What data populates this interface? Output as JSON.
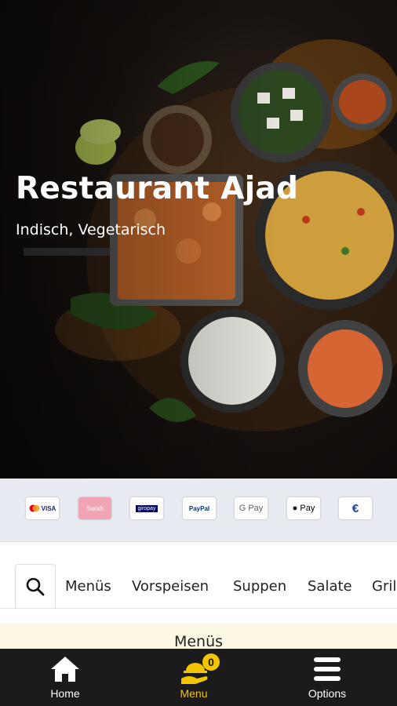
{
  "restaurant": {
    "name": "Restaurant Ajad",
    "cuisine": "Indisch, Vegetarisch"
  },
  "payments": [
    {
      "label": "VISA",
      "icon": "mastercard-visa-icon"
    },
    {
      "label": "Swish",
      "icon": "swish-icon"
    },
    {
      "label": "giropay",
      "icon": "giropay-icon"
    },
    {
      "label": "PayPal",
      "icon": "paypal-icon"
    },
    {
      "label": "G Pay",
      "icon": "google-pay-icon"
    },
    {
      "label": "Pay",
      "icon": "apple-pay-icon"
    },
    {
      "label": "€",
      "icon": "cash-euro-icon"
    }
  ],
  "categories": [
    "Menüs",
    "Vorspeisen",
    "Suppen",
    "Salate",
    "Gril"
  ],
  "section": {
    "title": "Menüs"
  },
  "tabbar": {
    "home": "Home",
    "menu": "Menu",
    "menu_badge": "0",
    "options": "Options"
  },
  "colors": {
    "accent": "#f3c400",
    "tabbar_bg": "#1b1b1b",
    "payments_bg": "#e8ecf2"
  }
}
